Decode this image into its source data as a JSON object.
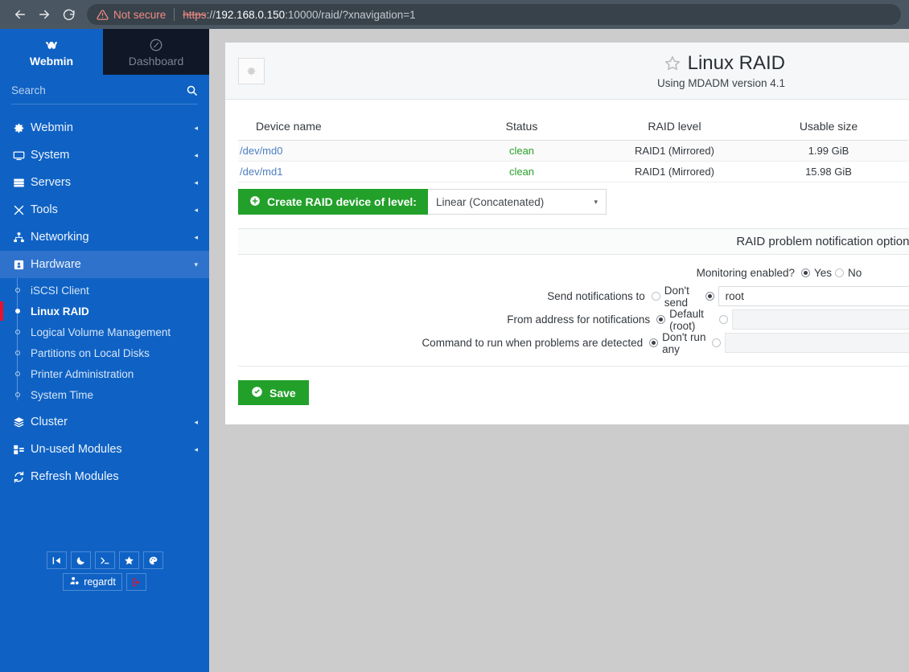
{
  "browser": {
    "back_icon": "arrow-left-icon",
    "forward_icon": "arrow-right-icon",
    "reload_icon": "reload-icon",
    "security_warning_icon": "warning-triangle-icon",
    "security_label": "Not secure",
    "url_scheme": "https",
    "url_separator": "://",
    "url_host": "192.168.0.150",
    "url_rest": ":10000/raid/?xnavigation=1"
  },
  "sidebar": {
    "tabs": [
      {
        "label": "Webmin",
        "icon": "webmin-logo-icon",
        "active": true
      },
      {
        "label": "Dashboard",
        "icon": "speedometer-icon",
        "active": false
      }
    ],
    "search": {
      "placeholder": "Search",
      "value": "",
      "icon": "search-icon"
    },
    "nav": [
      {
        "label": "Webmin",
        "icon": "gear-icon",
        "caret": "◂"
      },
      {
        "label": "System",
        "icon": "monitor-icon",
        "caret": "◂"
      },
      {
        "label": "Servers",
        "icon": "server-icon",
        "caret": "◂"
      },
      {
        "label": "Tools",
        "icon": "tools-icon",
        "caret": "◂"
      },
      {
        "label": "Networking",
        "icon": "network-icon",
        "caret": "◂"
      },
      {
        "label": "Hardware",
        "icon": "hardware-chip-icon",
        "caret": "▾",
        "expanded": true
      },
      {
        "label": "Cluster",
        "icon": "layers-icon",
        "caret": "◂"
      },
      {
        "label": "Un-used Modules",
        "icon": "puzzle-icon",
        "caret": "◂"
      },
      {
        "label": "Refresh Modules",
        "icon": "refresh-icon",
        "caret": ""
      }
    ],
    "hardware_submenu": [
      {
        "label": "iSCSI Client",
        "active": false
      },
      {
        "label": "Linux RAID",
        "active": true
      },
      {
        "label": "Logical Volume Management",
        "active": false
      },
      {
        "label": "Partitions on Local Disks",
        "active": false
      },
      {
        "label": "Printer Administration",
        "active": false
      },
      {
        "label": "System Time",
        "active": false
      }
    ],
    "footer_icons": [
      {
        "name": "collapse-sidebar-icon",
        "glyph": "❙◀"
      },
      {
        "name": "night-mode-icon",
        "glyph": "☾"
      },
      {
        "name": "terminal-icon",
        "glyph": ">_"
      },
      {
        "name": "favorites-star-icon",
        "glyph": "★"
      },
      {
        "name": "theme-palette-icon",
        "glyph": "◕"
      }
    ],
    "user": {
      "name": "regardt",
      "icon": "user-settings-icon"
    },
    "logout": {
      "icon": "logout-icon"
    }
  },
  "content": {
    "settings_icon": "gear-icon",
    "favorite_icon": "star-outline-icon",
    "title": "Linux RAID",
    "subtitle": "Using MDADM version 4.1",
    "table": {
      "headers": [
        "Device name",
        "Status",
        "RAID level",
        "Usable size"
      ],
      "rows": [
        {
          "device": "/dev/md0",
          "status": "clean",
          "level": "RAID1 (Mirrored)",
          "size": "1.99 GiB"
        },
        {
          "device": "/dev/md1",
          "status": "clean",
          "level": "RAID1 (Mirrored)",
          "size": "15.98 GiB"
        }
      ]
    },
    "create": {
      "button_label": "Create RAID device of level:",
      "button_icon": "plus-circle-icon",
      "selected_level": "Linear (Concatenated)",
      "caret": "▾"
    },
    "notify_panel": {
      "heading": "RAID problem notification options",
      "rows": [
        {
          "label": "Monitoring enabled?",
          "options": [
            {
              "text": "Yes",
              "selected": true
            },
            {
              "text": "No",
              "selected": false
            }
          ]
        },
        {
          "label": "Send notifications to",
          "options": [
            {
              "text": "Don't send",
              "selected": false
            }
          ],
          "field": {
            "value": "root",
            "selected": true,
            "disabled": false
          }
        },
        {
          "label": "From address for notifications",
          "options": [
            {
              "text": "Default (",
              "mono": "root",
              "text_tail": ")",
              "selected": true
            }
          ],
          "field": {
            "value": "",
            "selected": false,
            "disabled": true
          }
        },
        {
          "label": "Command to run when problems are detected",
          "options": [
            {
              "text": "Don't run any",
              "selected": true
            }
          ],
          "field": {
            "value": "",
            "selected": false,
            "disabled": true
          }
        }
      ]
    },
    "save": {
      "label": "Save",
      "icon": "check-circle-icon"
    }
  },
  "colors": {
    "sidebar_blue": "#0f62c4",
    "dashboard_dark": "#101726",
    "accent_green": "#22a02a",
    "link_blue": "#4c7fc0",
    "status_green": "#2aa02a",
    "active_marker_red": "#e8112d",
    "page_background": "#cccccc"
  }
}
